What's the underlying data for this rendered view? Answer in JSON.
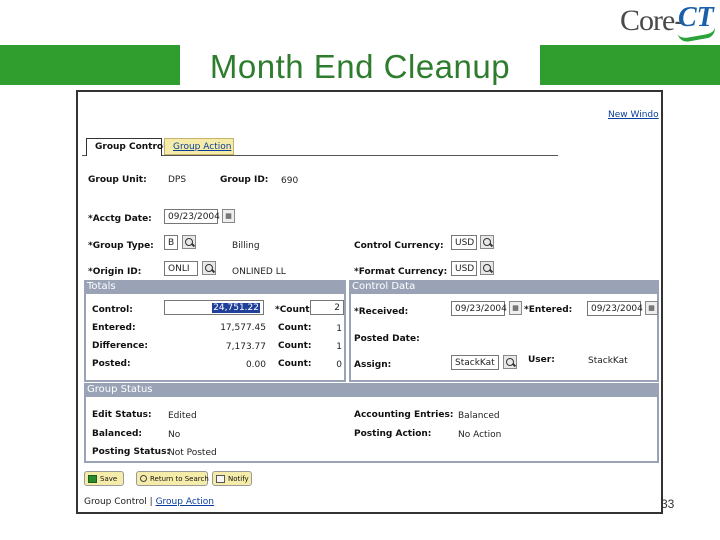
{
  "slide": {
    "title": "Month End Cleanup",
    "logo_text": "Core-",
    "logo_ct": "CT",
    "page_number": "33"
  },
  "window": {
    "new_window": "New Windo"
  },
  "tabs": [
    {
      "label": "Group Control"
    },
    {
      "label": "Group Action"
    }
  ],
  "header": {
    "group_unit_label": "Group Unit:",
    "group_unit_value": "DPS",
    "group_id_label": "Group ID:",
    "group_id_value": "690",
    "acctg_date_label": "*Acctg Date:",
    "acctg_date_value": "09/23/2004",
    "group_type_label": "*Group Type:",
    "group_type_value": "B",
    "group_type_desc": "Billing",
    "origin_id_label": "*Origin ID:",
    "origin_id_value": "ONLI",
    "origin_id_desc": "ONLINED LL",
    "control_currency_label": "Control Currency:",
    "control_currency_value": "USD",
    "format_currency_label": "*Format Currency:",
    "format_currency_value": "USD"
  },
  "totals": {
    "title": "Totals",
    "control_label": "Control:",
    "control_value": "24,751.22",
    "control_count_label": "*Count:",
    "control_count_value": "2",
    "entered_label": "Entered:",
    "entered_value": "17,577.45",
    "entered_count_label": "Count:",
    "entered_count_value": "1",
    "difference_label": "Difference:",
    "difference_value": "7,173.77",
    "difference_count_label": "Count:",
    "difference_count_value": "1",
    "posted_label": "Posted:",
    "posted_value": "0.00",
    "posted_count_label": "Count:",
    "posted_count_value": "0"
  },
  "control_data": {
    "title": "Control Data",
    "received_label": "*Received:",
    "received_value": "09/23/2004",
    "entered_label": "*Entered:",
    "entered_value": "09/23/2004",
    "posted_date_label": "Posted Date:",
    "assign_label": "Assign:",
    "assign_value": "StackKat",
    "user_label": "User:",
    "user_value": "StackKat"
  },
  "group_status": {
    "title": "Group Status",
    "edit_status_label": "Edit Status:",
    "edit_status_value": "Edited",
    "balanced_label": "Balanced:",
    "balanced_value": "No",
    "posting_status_label": "Posting Status:",
    "posting_status_value": "Not Posted",
    "accounting_entries_label": "Accounting Entries:",
    "accounting_entries_value": "Balanced",
    "posting_action_label": "Posting Action:",
    "posting_action_value": "No Action"
  },
  "buttons": {
    "save": "Save",
    "return_to_search": "Return to Search",
    "notify": "Notify"
  },
  "footer": {
    "link_group_control": "Group Control",
    "separator": " | ",
    "link_group_action": "Group Action"
  }
}
